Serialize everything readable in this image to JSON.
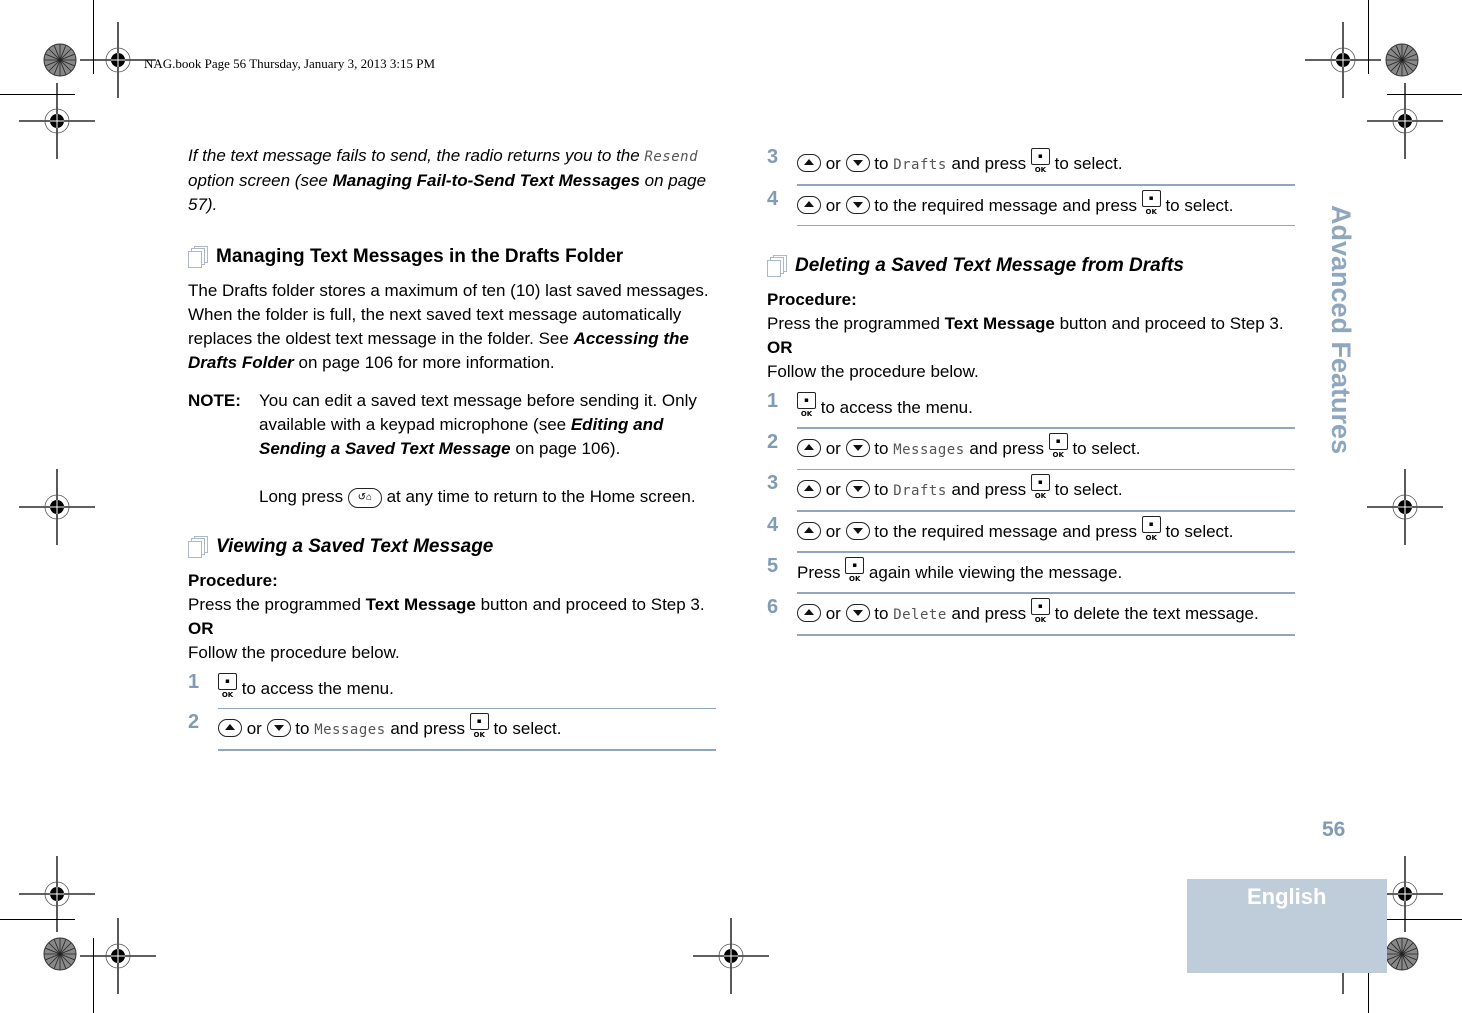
{
  "header": {
    "book_line": "NAG.book  Page 56  Thursday, January 3, 2013  3:15 PM"
  },
  "side_tab": {
    "label": "Advanced Features"
  },
  "page_number": "56",
  "language_tab": "English",
  "left_column": {
    "intro": {
      "part1": "If the text message fails to send, the radio returns you to the ",
      "lcd_resend": "Resend",
      "part2": " option screen (see ",
      "link": "Managing Fail-to-Send Text Messages",
      "part3": " on page 57)."
    },
    "section1": {
      "title": "Managing Text Messages in the Drafts Folder",
      "body_part1": "The Drafts folder stores a maximum of ten (10) last saved messages. When the folder is full, the next saved text message automatically replaces the oldest text message in the folder. See ",
      "body_link": "Accessing the Drafts Folder",
      "body_part2": " on page 106 for more information.",
      "note_label": "NOTE:",
      "note_part1": "You can edit a saved text message before sending it. Only available with a keypad microphone (see ",
      "note_link": "Editing and Sending a Saved Text Message",
      "note_part2": " on page 106).",
      "note2_part1": "Long press ",
      "note2_key": "back-home-key-icon",
      "note2_part2": " at any time to return to the Home screen."
    },
    "section2": {
      "title": "Viewing a Saved Text Message",
      "procedure_label": "Procedure:",
      "proc_part1": "Press the programmed ",
      "proc_bold": "Text Message",
      "proc_part2": " button and proceed to Step 3.",
      "or_label": "OR",
      "follow": "Follow the procedure below.",
      "steps": [
        {
          "num": "1",
          "text": " to access the menu."
        },
        {
          "num": "2",
          "or": " or ",
          "to": " to ",
          "lcd": "Messages",
          "press": " and press ",
          "end": " to select."
        }
      ]
    }
  },
  "right_column": {
    "steps_top": [
      {
        "num": "3",
        "or": " or ",
        "to": " to ",
        "lcd": "Drafts",
        "press": " and press ",
        "end": " to select."
      },
      {
        "num": "4",
        "or": " or ",
        "text": " to the required message and press ",
        "end": " to select."
      }
    ],
    "section3": {
      "title": "Deleting a Saved Text Message from Drafts",
      "procedure_label": "Procedure:",
      "proc_part1": "Press the programmed ",
      "proc_bold": "Text Message",
      "proc_part2": " button and proceed to Step 3.",
      "or_label": "OR",
      "follow": "Follow the procedure below.",
      "steps": [
        {
          "num": "1",
          "text": " to access the menu."
        },
        {
          "num": "2",
          "or": " or ",
          "to": " to ",
          "lcd": "Messages",
          "press": " and press ",
          "end": " to select."
        },
        {
          "num": "3",
          "or": " or ",
          "to": " to ",
          "lcd": "Drafts",
          "press": " and press ",
          "end": " to select."
        },
        {
          "num": "4",
          "or": " or ",
          "text": " to the required message and press ",
          "end": " to select."
        },
        {
          "num": "5",
          "pre": "Press ",
          "text": " again while viewing the message."
        },
        {
          "num": "6",
          "or": " or ",
          "to": " to ",
          "lcd": "Delete",
          "press": " and press ",
          "end": " to delete the text message."
        }
      ]
    }
  },
  "keys": {
    "ok_label": "▪ OK",
    "home_label": "↺⌂"
  },
  "colors": {
    "accent": "#7f9bb5",
    "rule": "#8ea7be",
    "lang_bg": "#bfcddb"
  }
}
